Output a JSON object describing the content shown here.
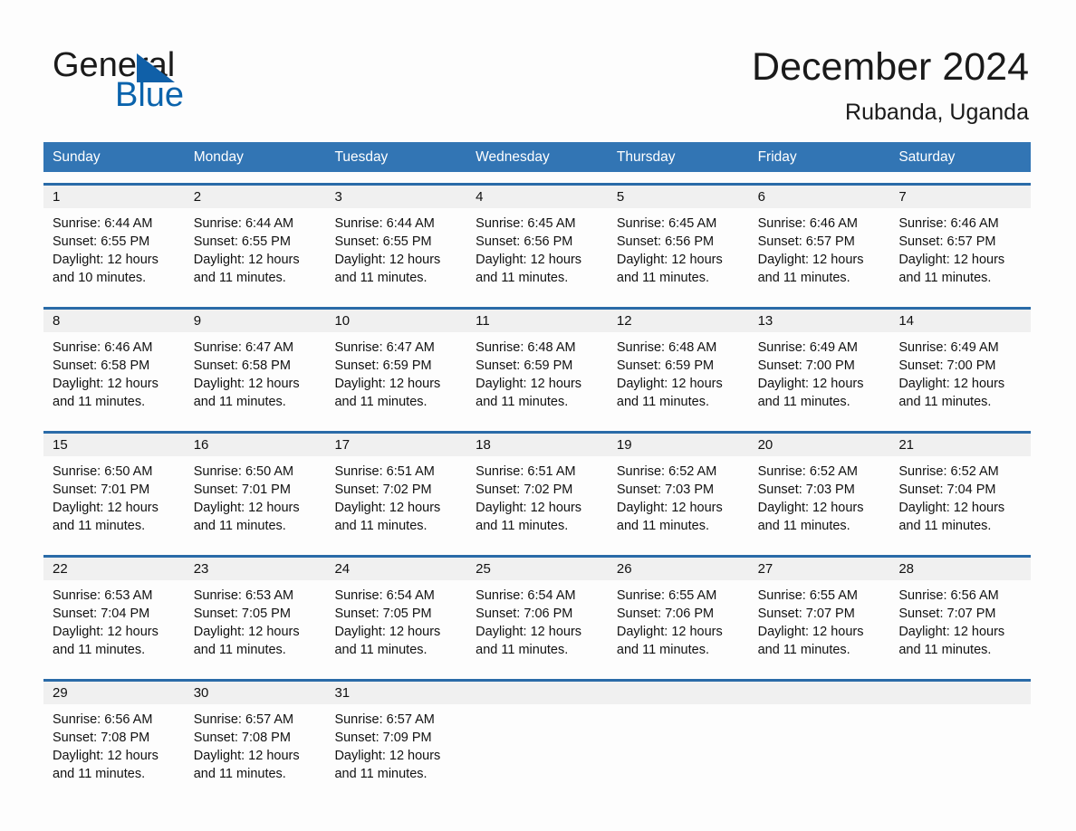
{
  "brand": {
    "name_part1": "General",
    "name_part2": "Blue",
    "triangle_color": "#1060a8",
    "blue_color": "#0a63ac"
  },
  "header": {
    "month_title": "December 2024",
    "location": "Rubanda, Uganda"
  },
  "theme": {
    "header_bg": "#3275b4",
    "row_border": "#2a6ba8",
    "daynum_bg": "#f0f0f0",
    "page_bg": "#fdfdfd",
    "text": "#111111"
  },
  "weekdays": [
    "Sunday",
    "Monday",
    "Tuesday",
    "Wednesday",
    "Thursday",
    "Friday",
    "Saturday"
  ],
  "weeks": [
    [
      {
        "day": "1",
        "sunrise": "Sunrise: 6:44 AM",
        "sunset": "Sunset: 6:55 PM",
        "daylight_line1": "Daylight: 12 hours",
        "daylight_line2": "and 10 minutes."
      },
      {
        "day": "2",
        "sunrise": "Sunrise: 6:44 AM",
        "sunset": "Sunset: 6:55 PM",
        "daylight_line1": "Daylight: 12 hours",
        "daylight_line2": "and 11 minutes."
      },
      {
        "day": "3",
        "sunrise": "Sunrise: 6:44 AM",
        "sunset": "Sunset: 6:55 PM",
        "daylight_line1": "Daylight: 12 hours",
        "daylight_line2": "and 11 minutes."
      },
      {
        "day": "4",
        "sunrise": "Sunrise: 6:45 AM",
        "sunset": "Sunset: 6:56 PM",
        "daylight_line1": "Daylight: 12 hours",
        "daylight_line2": "and 11 minutes."
      },
      {
        "day": "5",
        "sunrise": "Sunrise: 6:45 AM",
        "sunset": "Sunset: 6:56 PM",
        "daylight_line1": "Daylight: 12 hours",
        "daylight_line2": "and 11 minutes."
      },
      {
        "day": "6",
        "sunrise": "Sunrise: 6:46 AM",
        "sunset": "Sunset: 6:57 PM",
        "daylight_line1": "Daylight: 12 hours",
        "daylight_line2": "and 11 minutes."
      },
      {
        "day": "7",
        "sunrise": "Sunrise: 6:46 AM",
        "sunset": "Sunset: 6:57 PM",
        "daylight_line1": "Daylight: 12 hours",
        "daylight_line2": "and 11 minutes."
      }
    ],
    [
      {
        "day": "8",
        "sunrise": "Sunrise: 6:46 AM",
        "sunset": "Sunset: 6:58 PM",
        "daylight_line1": "Daylight: 12 hours",
        "daylight_line2": "and 11 minutes."
      },
      {
        "day": "9",
        "sunrise": "Sunrise: 6:47 AM",
        "sunset": "Sunset: 6:58 PM",
        "daylight_line1": "Daylight: 12 hours",
        "daylight_line2": "and 11 minutes."
      },
      {
        "day": "10",
        "sunrise": "Sunrise: 6:47 AM",
        "sunset": "Sunset: 6:59 PM",
        "daylight_line1": "Daylight: 12 hours",
        "daylight_line2": "and 11 minutes."
      },
      {
        "day": "11",
        "sunrise": "Sunrise: 6:48 AM",
        "sunset": "Sunset: 6:59 PM",
        "daylight_line1": "Daylight: 12 hours",
        "daylight_line2": "and 11 minutes."
      },
      {
        "day": "12",
        "sunrise": "Sunrise: 6:48 AM",
        "sunset": "Sunset: 6:59 PM",
        "daylight_line1": "Daylight: 12 hours",
        "daylight_line2": "and 11 minutes."
      },
      {
        "day": "13",
        "sunrise": "Sunrise: 6:49 AM",
        "sunset": "Sunset: 7:00 PM",
        "daylight_line1": "Daylight: 12 hours",
        "daylight_line2": "and 11 minutes."
      },
      {
        "day": "14",
        "sunrise": "Sunrise: 6:49 AM",
        "sunset": "Sunset: 7:00 PM",
        "daylight_line1": "Daylight: 12 hours",
        "daylight_line2": "and 11 minutes."
      }
    ],
    [
      {
        "day": "15",
        "sunrise": "Sunrise: 6:50 AM",
        "sunset": "Sunset: 7:01 PM",
        "daylight_line1": "Daylight: 12 hours",
        "daylight_line2": "and 11 minutes."
      },
      {
        "day": "16",
        "sunrise": "Sunrise: 6:50 AM",
        "sunset": "Sunset: 7:01 PM",
        "daylight_line1": "Daylight: 12 hours",
        "daylight_line2": "and 11 minutes."
      },
      {
        "day": "17",
        "sunrise": "Sunrise: 6:51 AM",
        "sunset": "Sunset: 7:02 PM",
        "daylight_line1": "Daylight: 12 hours",
        "daylight_line2": "and 11 minutes."
      },
      {
        "day": "18",
        "sunrise": "Sunrise: 6:51 AM",
        "sunset": "Sunset: 7:02 PM",
        "daylight_line1": "Daylight: 12 hours",
        "daylight_line2": "and 11 minutes."
      },
      {
        "day": "19",
        "sunrise": "Sunrise: 6:52 AM",
        "sunset": "Sunset: 7:03 PM",
        "daylight_line1": "Daylight: 12 hours",
        "daylight_line2": "and 11 minutes."
      },
      {
        "day": "20",
        "sunrise": "Sunrise: 6:52 AM",
        "sunset": "Sunset: 7:03 PM",
        "daylight_line1": "Daylight: 12 hours",
        "daylight_line2": "and 11 minutes."
      },
      {
        "day": "21",
        "sunrise": "Sunrise: 6:52 AM",
        "sunset": "Sunset: 7:04 PM",
        "daylight_line1": "Daylight: 12 hours",
        "daylight_line2": "and 11 minutes."
      }
    ],
    [
      {
        "day": "22",
        "sunrise": "Sunrise: 6:53 AM",
        "sunset": "Sunset: 7:04 PM",
        "daylight_line1": "Daylight: 12 hours",
        "daylight_line2": "and 11 minutes."
      },
      {
        "day": "23",
        "sunrise": "Sunrise: 6:53 AM",
        "sunset": "Sunset: 7:05 PM",
        "daylight_line1": "Daylight: 12 hours",
        "daylight_line2": "and 11 minutes."
      },
      {
        "day": "24",
        "sunrise": "Sunrise: 6:54 AM",
        "sunset": "Sunset: 7:05 PM",
        "daylight_line1": "Daylight: 12 hours",
        "daylight_line2": "and 11 minutes."
      },
      {
        "day": "25",
        "sunrise": "Sunrise: 6:54 AM",
        "sunset": "Sunset: 7:06 PM",
        "daylight_line1": "Daylight: 12 hours",
        "daylight_line2": "and 11 minutes."
      },
      {
        "day": "26",
        "sunrise": "Sunrise: 6:55 AM",
        "sunset": "Sunset: 7:06 PM",
        "daylight_line1": "Daylight: 12 hours",
        "daylight_line2": "and 11 minutes."
      },
      {
        "day": "27",
        "sunrise": "Sunrise: 6:55 AM",
        "sunset": "Sunset: 7:07 PM",
        "daylight_line1": "Daylight: 12 hours",
        "daylight_line2": "and 11 minutes."
      },
      {
        "day": "28",
        "sunrise": "Sunrise: 6:56 AM",
        "sunset": "Sunset: 7:07 PM",
        "daylight_line1": "Daylight: 12 hours",
        "daylight_line2": "and 11 minutes."
      }
    ],
    [
      {
        "day": "29",
        "sunrise": "Sunrise: 6:56 AM",
        "sunset": "Sunset: 7:08 PM",
        "daylight_line1": "Daylight: 12 hours",
        "daylight_line2": "and 11 minutes."
      },
      {
        "day": "30",
        "sunrise": "Sunrise: 6:57 AM",
        "sunset": "Sunset: 7:08 PM",
        "daylight_line1": "Daylight: 12 hours",
        "daylight_line2": "and 11 minutes."
      },
      {
        "day": "31",
        "sunrise": "Sunrise: 6:57 AM",
        "sunset": "Sunset: 7:09 PM",
        "daylight_line1": "Daylight: 12 hours",
        "daylight_line2": "and 11 minutes."
      },
      {
        "day": "",
        "sunrise": "",
        "sunset": "",
        "daylight_line1": "",
        "daylight_line2": ""
      },
      {
        "day": "",
        "sunrise": "",
        "sunset": "",
        "daylight_line1": "",
        "daylight_line2": ""
      },
      {
        "day": "",
        "sunrise": "",
        "sunset": "",
        "daylight_line1": "",
        "daylight_line2": ""
      },
      {
        "day": "",
        "sunrise": "",
        "sunset": "",
        "daylight_line1": "",
        "daylight_line2": ""
      }
    ]
  ]
}
